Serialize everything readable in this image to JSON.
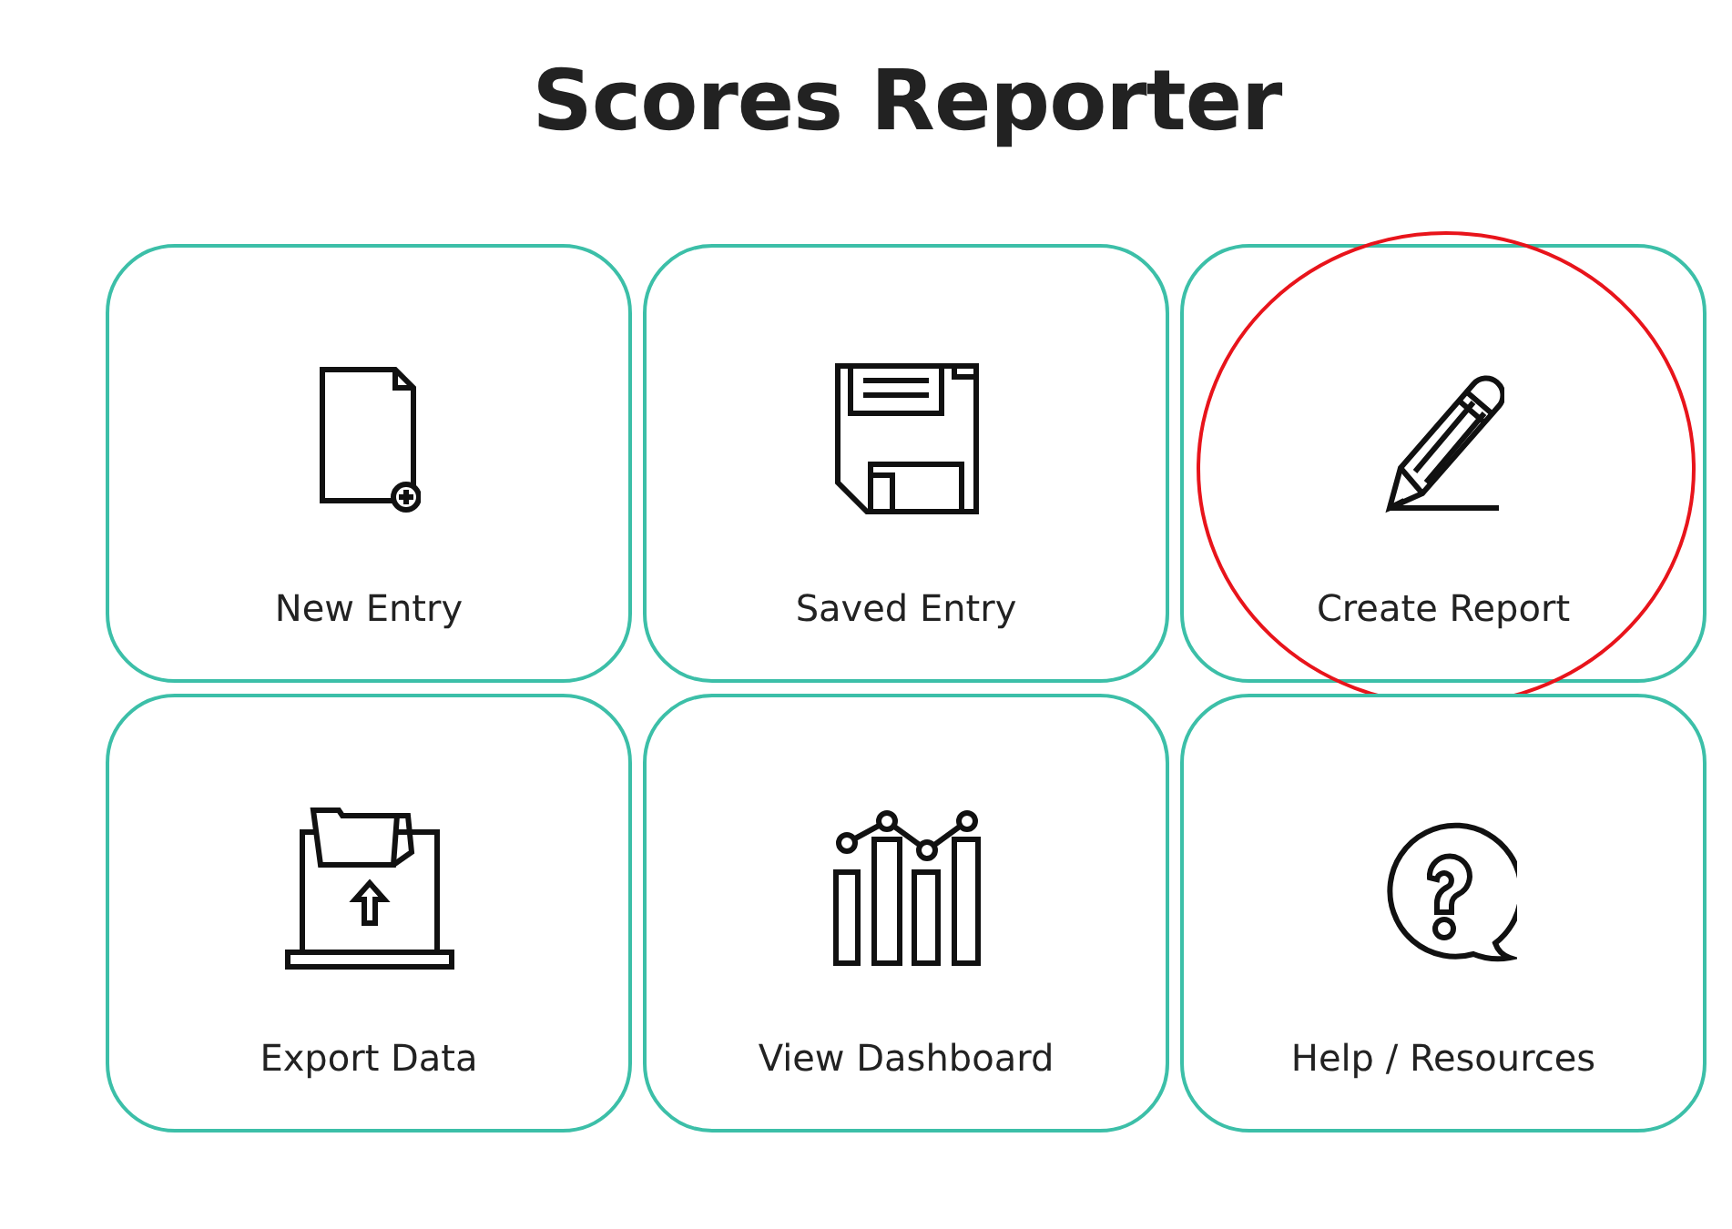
{
  "title": "Scores Reporter",
  "tiles": [
    {
      "kind": "new-document",
      "label": "New Entry",
      "circled": false
    },
    {
      "kind": "floppy",
      "label": "Saved Entry",
      "circled": false
    },
    {
      "kind": "pencil",
      "label": "Create Report",
      "circled": true
    },
    {
      "kind": "upload-folder",
      "label": "Export Data",
      "circled": false
    },
    {
      "kind": "chart",
      "label": "View Dashboard",
      "circled": false
    },
    {
      "kind": "question",
      "label": "Help / Resources",
      "circled": false
    }
  ]
}
